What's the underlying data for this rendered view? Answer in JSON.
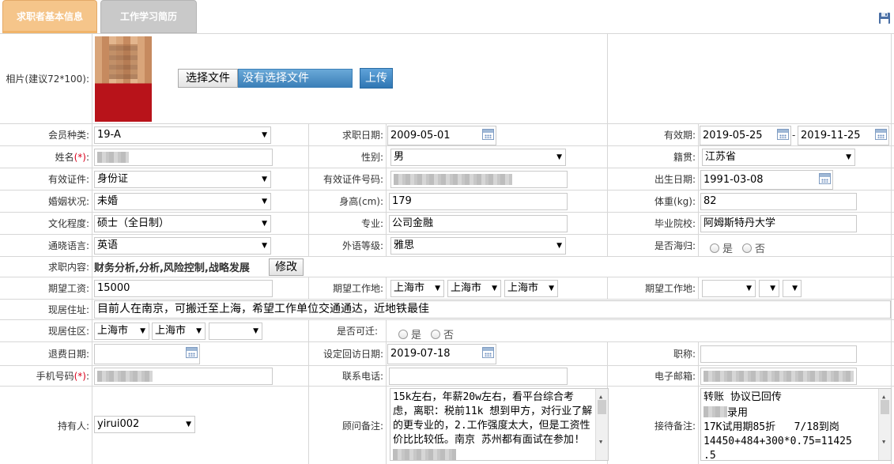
{
  "tabs": {
    "basic": "求职者基本信息",
    "history": "工作学习简历"
  },
  "photo": {
    "label": "相片(建议72*100):",
    "choose_file": "选择文件",
    "no_file": "没有选择文件",
    "upload": "上传"
  },
  "rows": {
    "member_type": {
      "label": "会员种类:",
      "value": "19-A"
    },
    "job_date": {
      "label": "求职日期:",
      "value": "2009-05-01"
    },
    "valid_period": {
      "label": "有效期:",
      "from": "2019-05-25",
      "sep": "-",
      "to": "2019-11-25"
    },
    "name": {
      "label": "姓名",
      "req": "(*)",
      "colon": ":"
    },
    "gender": {
      "label": "性别:",
      "value": "男"
    },
    "native_place": {
      "label": "籍贯:",
      "value": "江苏省"
    },
    "id_type": {
      "label": "有效证件:",
      "value": "身份证"
    },
    "id_number": {
      "label": "有效证件号码:"
    },
    "birth_date": {
      "label": "出生日期:",
      "value": "1991-03-08"
    },
    "marital": {
      "label": "婚姻状况:",
      "value": "未婚"
    },
    "height": {
      "label": "身高(cm):",
      "value": "179"
    },
    "weight": {
      "label": "体重(kg):",
      "value": "82"
    },
    "education": {
      "label": "文化程度:",
      "value": "硕士（全日制）"
    },
    "major": {
      "label": "专业:",
      "value": "公司金融"
    },
    "school": {
      "label": "毕业院校:",
      "value": "阿姆斯特丹大学"
    },
    "language": {
      "label": "通晓语言:",
      "value": "英语"
    },
    "language_level": {
      "label": "外语等级:",
      "value": "雅思"
    },
    "returnee": {
      "label": "是否海归:",
      "yes": "是",
      "no": "否"
    },
    "job_content": {
      "label": "求职内容:",
      "value": "财务分析,分析,风险控制,战略发展",
      "modify": "修改"
    },
    "expected_salary": {
      "label": "期望工资:",
      "value": "15000"
    },
    "expected_location": {
      "label": "期望工作地:",
      "v1": "上海市",
      "v2": "上海市",
      "v3": "上海市"
    },
    "expected_location2": {
      "label": "期望工作地:"
    },
    "address": {
      "label": "现居住址:",
      "value": "目前人在南京，可搬迁至上海，希望工作单位交通通达，近地铁最佳"
    },
    "district": {
      "label": "现居住区:",
      "v1": "上海市",
      "v2": "上海市"
    },
    "relocate": {
      "label": "是否可迁:",
      "yes": "是",
      "no": "否"
    },
    "refund_date": {
      "label": "退费日期:"
    },
    "revisit_date": {
      "label": "设定回访日期:",
      "value": "2019-07-18"
    },
    "title": {
      "label": "职称:"
    },
    "mobile": {
      "label": "手机号码",
      "req": "(*)",
      "colon": ":"
    },
    "phone": {
      "label": "联系电话:"
    },
    "email": {
      "label": "电子邮箱:"
    },
    "holder": {
      "label": "持有人:",
      "value": "yirui002"
    },
    "consultant_note": {
      "label": "顾问备注:",
      "value": "15k左右，年薪20w左右，看平台综合考虑，离职：税前11k 想到甲方，对行业了解的更专业的，2.工作强度太大，但是工资性价比比较低。南京 苏州都有面试在参加!"
    },
    "reception_note": {
      "label": "接待备注:",
      "line1": "转账 协议已回传",
      "line2": "录用",
      "line3": "17K试用期85折   7/18到岗",
      "line4": "14450+484+300*0.75=11425",
      "line5": ".5"
    }
  }
}
